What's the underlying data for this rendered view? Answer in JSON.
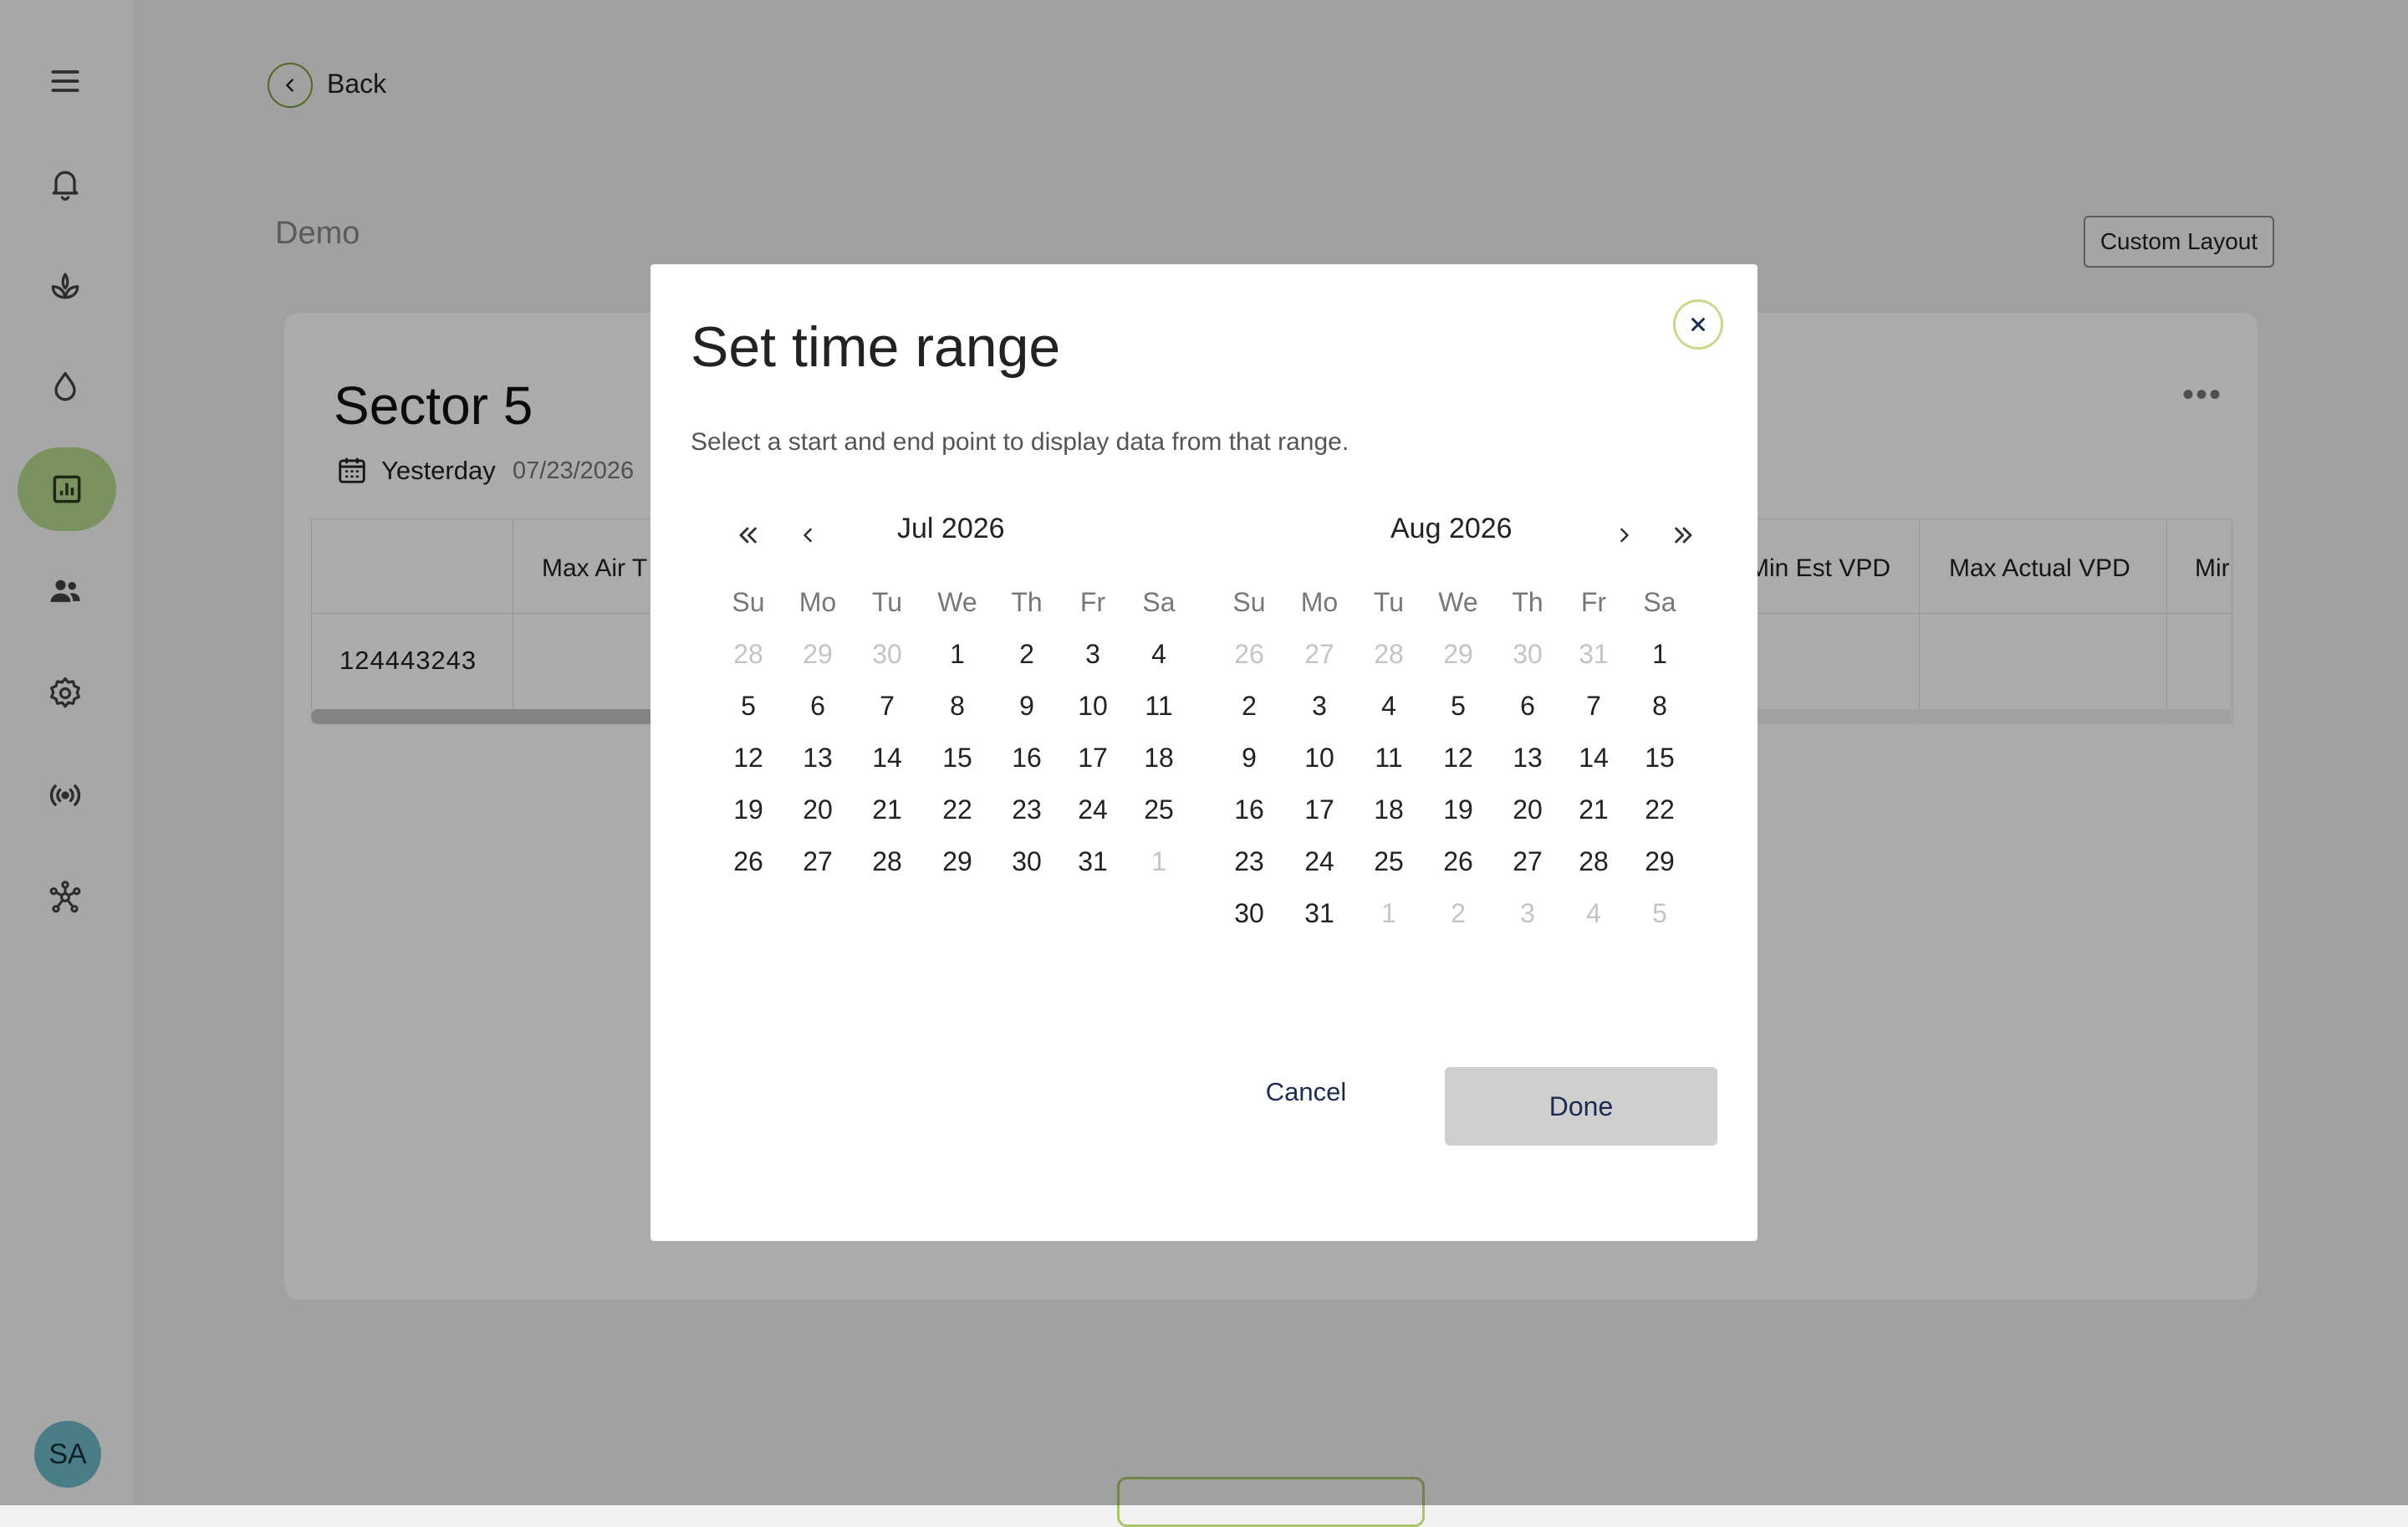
{
  "sidebar": {
    "items": [
      {
        "name": "menu-icon"
      },
      {
        "name": "bell-icon"
      },
      {
        "name": "plant-icon"
      },
      {
        "name": "water-drop-icon"
      },
      {
        "name": "chart-icon",
        "active": true
      },
      {
        "name": "users-icon"
      },
      {
        "name": "gear-icon"
      },
      {
        "name": "broadcast-icon"
      },
      {
        "name": "network-icon"
      }
    ],
    "avatar": "SA"
  },
  "header": {
    "back_label": "Back",
    "title": "Demo",
    "custom_layout_label": "Custom Layout"
  },
  "card": {
    "title": "Sector 5",
    "range_label": "Yesterday",
    "range_date": "07/23/2026",
    "more_label": "•••",
    "columns": [
      "Max Air T",
      "Min Est VPD",
      "Max Actual VPD",
      "Mir"
    ],
    "rows": [
      {
        "id": "124443243"
      }
    ]
  },
  "modal": {
    "title": "Set time range",
    "subtitle": "Select a start and end point to display data from that range.",
    "cancel_label": "Cancel",
    "done_label": "Done",
    "weekdays": [
      "Su",
      "Mo",
      "Tu",
      "We",
      "Th",
      "Fr",
      "Sa"
    ],
    "months": [
      {
        "label": "Jul 2026",
        "weeks": [
          [
            {
              "d": "28",
              "m": true
            },
            {
              "d": "29",
              "m": true
            },
            {
              "d": "30",
              "m": true
            },
            {
              "d": "1"
            },
            {
              "d": "2"
            },
            {
              "d": "3"
            },
            {
              "d": "4"
            }
          ],
          [
            {
              "d": "5"
            },
            {
              "d": "6"
            },
            {
              "d": "7"
            },
            {
              "d": "8"
            },
            {
              "d": "9"
            },
            {
              "d": "10"
            },
            {
              "d": "11"
            }
          ],
          [
            {
              "d": "12"
            },
            {
              "d": "13"
            },
            {
              "d": "14"
            },
            {
              "d": "15"
            },
            {
              "d": "16"
            },
            {
              "d": "17"
            },
            {
              "d": "18"
            }
          ],
          [
            {
              "d": "19"
            },
            {
              "d": "20"
            },
            {
              "d": "21"
            },
            {
              "d": "22"
            },
            {
              "d": "23"
            },
            {
              "d": "24"
            },
            {
              "d": "25"
            }
          ],
          [
            {
              "d": "26"
            },
            {
              "d": "27"
            },
            {
              "d": "28"
            },
            {
              "d": "29"
            },
            {
              "d": "30"
            },
            {
              "d": "31"
            },
            {
              "d": "1",
              "m": true
            }
          ]
        ]
      },
      {
        "label": "Aug 2026",
        "weeks": [
          [
            {
              "d": "26",
              "m": true
            },
            {
              "d": "27",
              "m": true
            },
            {
              "d": "28",
              "m": true
            },
            {
              "d": "29",
              "m": true
            },
            {
              "d": "30",
              "m": true
            },
            {
              "d": "31",
              "m": true
            },
            {
              "d": "1"
            }
          ],
          [
            {
              "d": "2"
            },
            {
              "d": "3"
            },
            {
              "d": "4"
            },
            {
              "d": "5"
            },
            {
              "d": "6"
            },
            {
              "d": "7"
            },
            {
              "d": "8"
            }
          ],
          [
            {
              "d": "9"
            },
            {
              "d": "10"
            },
            {
              "d": "11"
            },
            {
              "d": "12"
            },
            {
              "d": "13"
            },
            {
              "d": "14"
            },
            {
              "d": "15"
            }
          ],
          [
            {
              "d": "16"
            },
            {
              "d": "17"
            },
            {
              "d": "18"
            },
            {
              "d": "19"
            },
            {
              "d": "20"
            },
            {
              "d": "21"
            },
            {
              "d": "22"
            }
          ],
          [
            {
              "d": "23"
            },
            {
              "d": "24"
            },
            {
              "d": "25"
            },
            {
              "d": "26"
            },
            {
              "d": "27"
            },
            {
              "d": "28"
            },
            {
              "d": "29"
            }
          ],
          [
            {
              "d": "30"
            },
            {
              "d": "31"
            },
            {
              "d": "1",
              "m": true
            },
            {
              "d": "2",
              "m": true
            },
            {
              "d": "3",
              "m": true
            },
            {
              "d": "4",
              "m": true
            },
            {
              "d": "5",
              "m": true
            }
          ]
        ]
      }
    ]
  },
  "colors": {
    "accent": "#b7d88f",
    "accent_border": "#7a9a3c",
    "overlay": "#000000",
    "done_bg": "#cfcfcf"
  }
}
